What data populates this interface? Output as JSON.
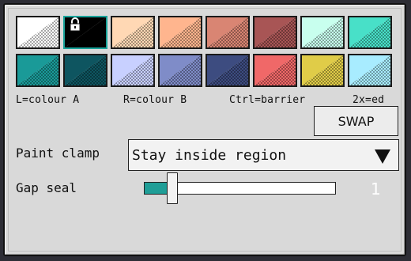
{
  "palette": {
    "row1": [
      {
        "name": "white",
        "a": "#ffffff",
        "b": "#ffffff",
        "state": "colour-a"
      },
      {
        "name": "black",
        "a": "#000000",
        "b": "#000000",
        "state": "colour-b-locked"
      },
      {
        "name": "peach",
        "a": "#ffd8b4",
        "b": "#ffd8b4"
      },
      {
        "name": "salmon",
        "a": "#ffb58e",
        "b": "#ffb58e"
      },
      {
        "name": "terracotta",
        "a": "#d98573",
        "b": "#d98573"
      },
      {
        "name": "brick-red",
        "a": "#a85555",
        "b": "#a85555"
      },
      {
        "name": "mint",
        "a": "#c8ffee",
        "b": "#c8ffee"
      },
      {
        "name": "turquoise",
        "a": "#48e0c8",
        "b": "#48e0c8"
      }
    ],
    "row2": [
      {
        "name": "teal",
        "a": "#1a9a98",
        "b": "#1a9a98"
      },
      {
        "name": "dark-teal",
        "a": "#0e5560",
        "b": "#0e5560"
      },
      {
        "name": "lavender",
        "a": "#c8d0ff",
        "b": "#c8d0ff"
      },
      {
        "name": "periwinkle",
        "a": "#7f8cc8",
        "b": "#7f8cc8"
      },
      {
        "name": "navy",
        "a": "#3d4c80",
        "b": "#3d4c80"
      },
      {
        "name": "coral-red",
        "a": "#f06868",
        "b": "#f06868"
      },
      {
        "name": "mustard",
        "a": "#e0cc48",
        "b": "#e0cc48"
      },
      {
        "name": "sky-blue",
        "a": "#a8ecff",
        "b": "#a8ecff"
      }
    ]
  },
  "hints": {
    "left": "L=colour A",
    "right": "R=colour B",
    "ctrl": "Ctrl=barrier",
    "double": "2x=ed"
  },
  "swap_button": {
    "label": "SWAP"
  },
  "paint_clamp": {
    "label": "Paint clamp",
    "selected": "Stay inside region"
  },
  "gap_seal": {
    "label": "Gap seal",
    "value": "1",
    "fraction": 0.12
  },
  "colors": {
    "accent": "#1f9e97",
    "panel": "#d9d9d9",
    "background": "#2d2d35"
  },
  "icons": {
    "lock": "lock-icon",
    "caret": "caret-down-icon"
  }
}
